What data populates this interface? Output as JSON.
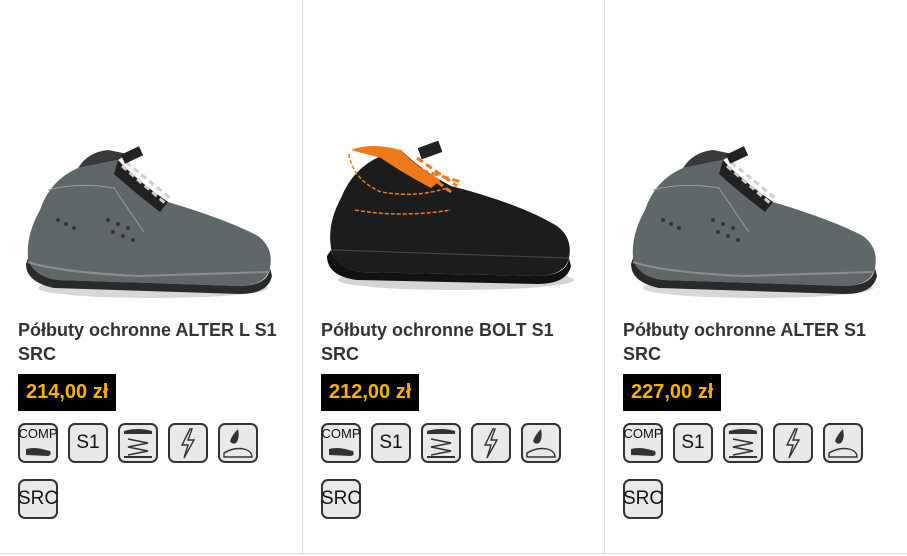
{
  "products": [
    {
      "title": "Półbuty ochronne ALTER L S1 SRC",
      "price": "214,00 zł",
      "shoe_style": "grey-suede",
      "badges": [
        "COMP",
        "S1",
        "SRC"
      ]
    },
    {
      "title": "Półbuty ochronne BOLT S1 SRC",
      "price": "212,00 zł",
      "shoe_style": "black-leather-orange",
      "badges": [
        "COMP",
        "S1",
        "SRC"
      ]
    },
    {
      "title": "Półbuty ochronne ALTER S1 SRC",
      "price": "227,00 zł",
      "shoe_style": "grey-suede",
      "badges": [
        "COMP",
        "S1",
        "SRC"
      ]
    }
  ],
  "colors": {
    "price_bg": "#000000",
    "price_text": "#f7b100",
    "accent_orange": "#f07a1a"
  }
}
